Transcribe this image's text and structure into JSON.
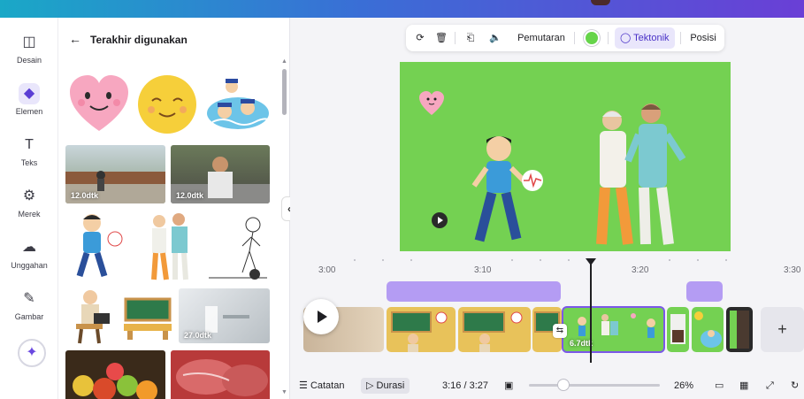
{
  "app": {
    "accent": "#7b58e8",
    "canvas_color": "#74d152"
  },
  "rail": {
    "items": [
      {
        "label": "Desain",
        "icon": "design-icon"
      },
      {
        "label": "Elemen",
        "icon": "elements-icon"
      },
      {
        "label": "Teks",
        "icon": "text-icon"
      },
      {
        "label": "Merek",
        "icon": "brand-icon"
      },
      {
        "label": "Unggahan",
        "icon": "upload-icon"
      },
      {
        "label": "Gambar",
        "icon": "draw-icon"
      }
    ]
  },
  "panel": {
    "title": "Terakhir digunakan",
    "durations": [
      "12.0dtk",
      "12.0dtk",
      "27.0dtk"
    ]
  },
  "toolbar": {
    "playback_label": "Pemutaran",
    "effect_label": "Tektonik",
    "position_label": "Posisi",
    "color": "#66d44a"
  },
  "timeline": {
    "ticks": [
      "3:00",
      "3:10",
      "3:20",
      "3:30"
    ],
    "selected_clip_duration": "6.7dtk"
  },
  "bottom": {
    "notes_label": "Catatan",
    "duration_label": "Durasi",
    "time": "3:16 / 3:27",
    "zoom": "26%",
    "zoom_fraction": 0.26
  }
}
